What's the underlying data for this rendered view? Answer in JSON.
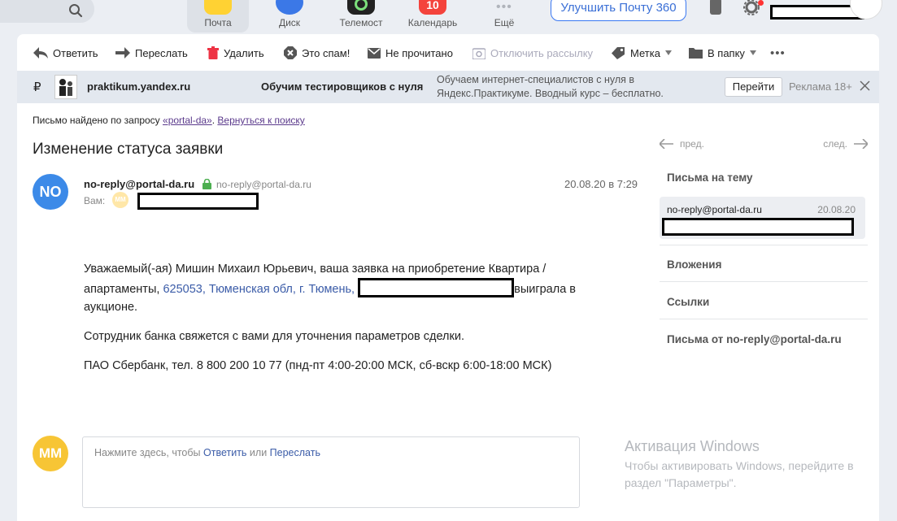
{
  "topbar": {
    "apps": [
      {
        "label": "Почта",
        "icon": "mail-icon",
        "color": "#ffd233"
      },
      {
        "label": "Диск",
        "icon": "disk-icon",
        "color": "#3b78e7"
      },
      {
        "label": "Телемост",
        "icon": "telemost-icon",
        "color": "#222222"
      },
      {
        "label": "Календарь",
        "icon": "calendar-icon",
        "color": "#f4433c",
        "badge": "10"
      },
      {
        "label": "Ещё",
        "icon": "more-icon",
        "color": "#b0b4bb"
      }
    ],
    "upgrade_label": "Улучшить Почту 360"
  },
  "toolbar": {
    "reply": "Ответить",
    "forward": "Переслать",
    "delete": "Удалить",
    "spam": "Это спам!",
    "unread": "Не прочитано",
    "unsubscribe": "Отключить рассылку",
    "label": "Метка",
    "folder": "В папку"
  },
  "ad": {
    "currency": "₽",
    "domain": "praktikum.yandex.ru",
    "title": "Обучим тестировщиков с нуля",
    "description": "Обучаем интернет-специалистов с нуля в Яндекс.Практикуме. Вводный курс – бесплатно.",
    "button": "Перейти",
    "label": "Реклама 18+"
  },
  "search_notice": {
    "prefix": "Письмо найдено по запросу ",
    "query": "«portal-da»",
    "separator": ". ",
    "back_link": "Вернуться к поиску"
  },
  "message": {
    "subject": "Изменение статуса заявки",
    "sender_initials": "NO",
    "from": "no-reply@portal-da.ru",
    "from_verified": "no-reply@portal-da.ru",
    "date": "20.08.20 в 7:29",
    "to_label": "Вам:",
    "to_initials": "MM",
    "body": {
      "p1_start": "Уважаемый(-ая) Мишин Михаил Юрьевич, ваша заявка на приобретение Квартира / апартаменты, ",
      "p1_address": "625053, Тюменская обл, г. Тюмень,",
      "p1_end": "выиграла в аукционе.",
      "p2": "Сотрудник банка свяжется с вами для уточнения параметров сделки.",
      "p3": "ПАО Сбербанк, тел. 8 800 200 10 77 (пнд-пт 4:00-20:00 МСК, сб-вскр 6:00-18:00 МСК)"
    }
  },
  "reply": {
    "initials": "MM",
    "prompt": "Нажмите здесь, чтобы ",
    "reply_link": "Ответить",
    "or": " или ",
    "forward_link": "Переслать"
  },
  "sidebar": {
    "prev": "пред.",
    "next": "след.",
    "thread_title": "Письма на тему",
    "thread_sender": "no-reply@portal-da.ru",
    "thread_date": "20.08.20",
    "attachments": "Вложения",
    "links": "Ссылки",
    "from_sender": "Письма от no-reply@portal-da.ru"
  },
  "watermark": {
    "title": "Активация Windows",
    "text": "Чтобы активировать Windows, перейдите в раздел \"Параметры\"."
  }
}
